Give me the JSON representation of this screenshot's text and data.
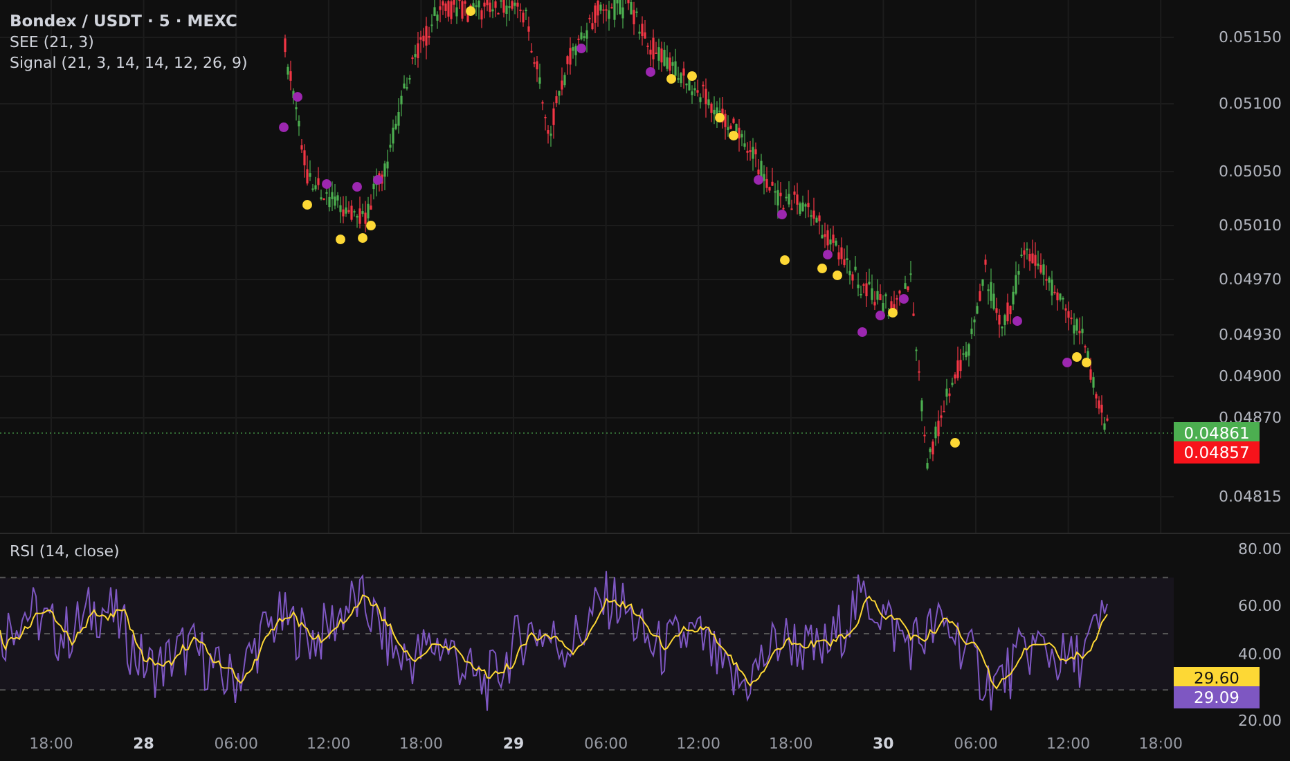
{
  "legend": [
    "Bondex / USDT · 5 · MEXC",
    "SEE (21, 3)",
    "Signal (21, 3, 14, 14, 12, 26, 9)"
  ],
  "price_axis": {
    "labels": [
      "0.05150",
      "0.05100",
      "0.05050",
      "0.05010",
      "0.04970",
      "0.04930",
      "0.04900",
      "0.04870",
      "0.04815"
    ],
    "badges": [
      {
        "value": "0.04861",
        "color": "#4caf50"
      },
      {
        "value": "0.04857",
        "color": "#f7131b"
      }
    ]
  },
  "rsi": {
    "title": "RSI (14, close)",
    "labels": [
      "80.00",
      "60.00",
      "40.00",
      "20.00"
    ],
    "badges": [
      {
        "value": "29.60",
        "color": "#fdd835"
      },
      {
        "value": "29.09",
        "color": "#7e57c2"
      }
    ]
  },
  "time_axis": [
    {
      "label": "18:00",
      "kind": "time"
    },
    {
      "label": "28",
      "kind": "date"
    },
    {
      "label": "06:00",
      "kind": "time"
    },
    {
      "label": "12:00",
      "kind": "time"
    },
    {
      "label": "18:00",
      "kind": "time"
    },
    {
      "label": "29",
      "kind": "date"
    },
    {
      "label": "06:00",
      "kind": "time"
    },
    {
      "label": "12:00",
      "kind": "time"
    },
    {
      "label": "18:00",
      "kind": "time"
    },
    {
      "label": "30",
      "kind": "date"
    },
    {
      "label": "06:00",
      "kind": "time"
    },
    {
      "label": "12:00",
      "kind": "time"
    },
    {
      "label": "18:00",
      "kind": "time"
    }
  ]
}
